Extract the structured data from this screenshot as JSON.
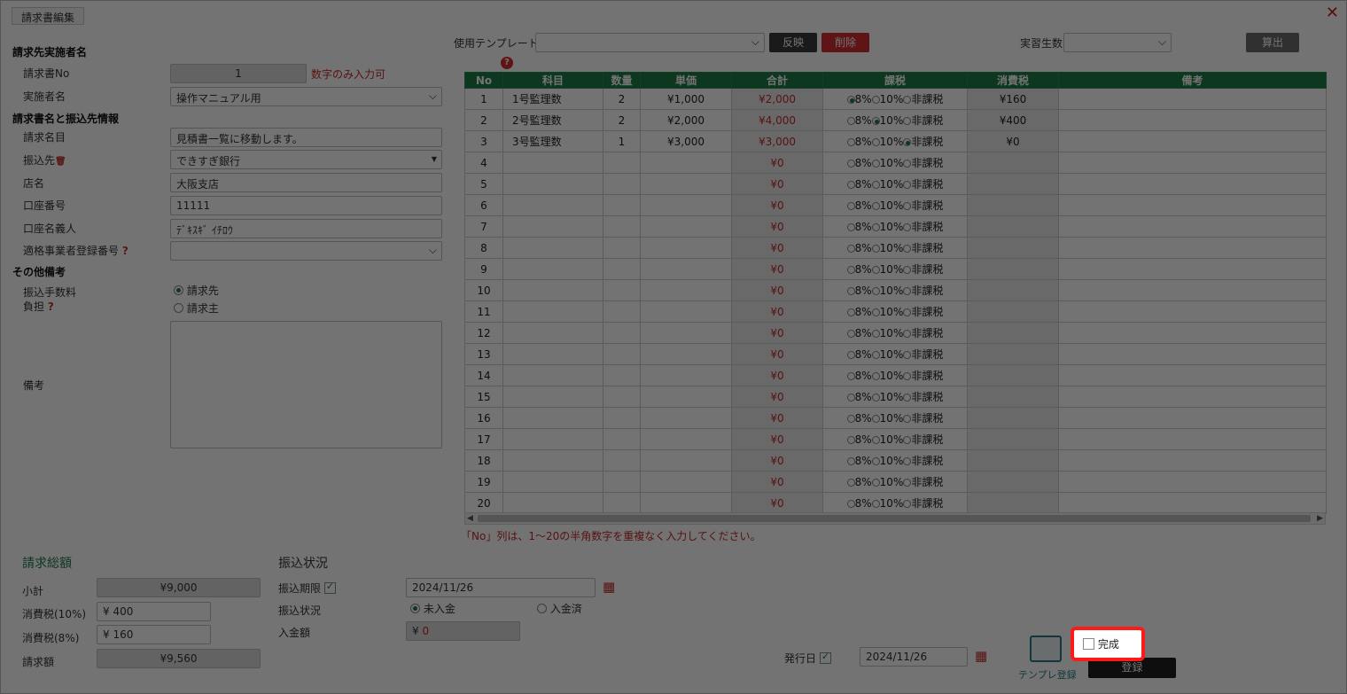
{
  "window": {
    "tab_title": "請求書編集",
    "close_label": "✕"
  },
  "left": {
    "section1": "請求先実施者名",
    "invoice_no_label": "請求書No",
    "invoice_no_value": "1",
    "invoice_no_hint": "数字のみ入力可",
    "implementer_label": "実施者名",
    "implementer_value": "操作マニュアル用",
    "section2": "請求書名と振込先情報",
    "invoice_name_label": "請求名目",
    "invoice_name_value": "見積書一覧に移動します。",
    "bank_label": "振込先",
    "bank_value": "できすぎ銀行",
    "branch_label": "店名",
    "branch_value": "大阪支店",
    "account_no_label": "口座番号",
    "account_no_value": "11111",
    "account_name_label": "口座名義人",
    "account_name_value": "ﾃﾞｷｽｷﾞ ｲﾁﾛｳ",
    "reg_no_label": "適格事業者登録番号",
    "reg_no_value": "",
    "section3": "その他備考",
    "fee_label_1": "振込手数料",
    "fee_label_2": "負担",
    "fee_opt1": "請求先",
    "fee_opt2": "請求主",
    "remarks_label": "備考",
    "remarks_value": ""
  },
  "toolbar": {
    "template_label": "使用テンプレート",
    "template_value": "",
    "apply_button": "反映",
    "delete_button": "削除",
    "trainees_label": "実習生数",
    "trainees_value": "",
    "calc_button": "算出"
  },
  "grid": {
    "headers": [
      "No",
      "科目",
      "数量",
      "単価",
      "合計",
      "課税",
      "消費税",
      "備考"
    ],
    "rows": [
      {
        "no": "1",
        "item": "1号監理数",
        "qty": "2",
        "price": "¥1,000",
        "total": "¥2,000",
        "tax": "8%",
        "ctax": "¥160"
      },
      {
        "no": "2",
        "item": "2号監理数",
        "qty": "2",
        "price": "¥2,000",
        "total": "¥4,000",
        "tax": "10%",
        "ctax": "¥400"
      },
      {
        "no": "3",
        "item": "3号監理数",
        "qty": "1",
        "price": "¥3,000",
        "total": "¥3,000",
        "tax": "非課税",
        "ctax": "¥0"
      },
      {
        "no": "4",
        "item": "",
        "qty": "",
        "price": "",
        "total": "¥0",
        "tax": "",
        "ctax": ""
      },
      {
        "no": "5",
        "item": "",
        "qty": "",
        "price": "",
        "total": "¥0",
        "tax": "",
        "ctax": ""
      },
      {
        "no": "6",
        "item": "",
        "qty": "",
        "price": "",
        "total": "¥0",
        "tax": "",
        "ctax": ""
      },
      {
        "no": "7",
        "item": "",
        "qty": "",
        "price": "",
        "total": "¥0",
        "tax": "",
        "ctax": ""
      },
      {
        "no": "8",
        "item": "",
        "qty": "",
        "price": "",
        "total": "¥0",
        "tax": "",
        "ctax": ""
      },
      {
        "no": "9",
        "item": "",
        "qty": "",
        "price": "",
        "total": "¥0",
        "tax": "",
        "ctax": ""
      },
      {
        "no": "10",
        "item": "",
        "qty": "",
        "price": "",
        "total": "¥0",
        "tax": "",
        "ctax": ""
      },
      {
        "no": "11",
        "item": "",
        "qty": "",
        "price": "",
        "total": "¥0",
        "tax": "",
        "ctax": ""
      },
      {
        "no": "12",
        "item": "",
        "qty": "",
        "price": "",
        "total": "¥0",
        "tax": "",
        "ctax": ""
      },
      {
        "no": "13",
        "item": "",
        "qty": "",
        "price": "",
        "total": "¥0",
        "tax": "",
        "ctax": ""
      },
      {
        "no": "14",
        "item": "",
        "qty": "",
        "price": "",
        "total": "¥0",
        "tax": "",
        "ctax": ""
      },
      {
        "no": "15",
        "item": "",
        "qty": "",
        "price": "",
        "total": "¥0",
        "tax": "",
        "ctax": ""
      },
      {
        "no": "16",
        "item": "",
        "qty": "",
        "price": "",
        "total": "¥0",
        "tax": "",
        "ctax": ""
      },
      {
        "no": "17",
        "item": "",
        "qty": "",
        "price": "",
        "total": "¥0",
        "tax": "",
        "ctax": ""
      },
      {
        "no": "18",
        "item": "",
        "qty": "",
        "price": "",
        "total": "¥0",
        "tax": "",
        "ctax": ""
      },
      {
        "no": "19",
        "item": "",
        "qty": "",
        "price": "",
        "total": "¥0",
        "tax": "",
        "ctax": ""
      },
      {
        "no": "20",
        "item": "",
        "qty": "",
        "price": "",
        "total": "¥0",
        "tax": "",
        "ctax": ""
      }
    ],
    "tax_options": [
      "8%",
      "10%",
      "非課税"
    ],
    "note": "「No」列は、1～20の半角数字を重複なく入力してください。"
  },
  "totals": {
    "title": "請求総額",
    "subtotal_label": "小計",
    "subtotal_value": "¥9,000",
    "tax10_label": "消費税(10%)",
    "tax10_value": "400",
    "tax8_label": "消費税(8%)",
    "tax8_value": "160",
    "total_label": "請求額",
    "total_value": "¥9,560",
    "yen": "¥"
  },
  "transfer": {
    "title": "振込状況",
    "deadline_label": "振込期限",
    "deadline_value": "2024/11/26",
    "status_label": "振込状況",
    "status_opt1": "未入金",
    "status_opt2": "入金済",
    "amount_label": "入金額",
    "amount_yen": "¥",
    "amount_value": "0"
  },
  "footer": {
    "issue_label": "発行日",
    "issue_value": "2024/11/26",
    "template_reg": "テンプレ登録",
    "complete_label": "完成",
    "register_button": "登録"
  },
  "colors": {
    "accent": "#1e7a46",
    "danger": "#d32f2f",
    "highlight": "#ff1a1a"
  }
}
